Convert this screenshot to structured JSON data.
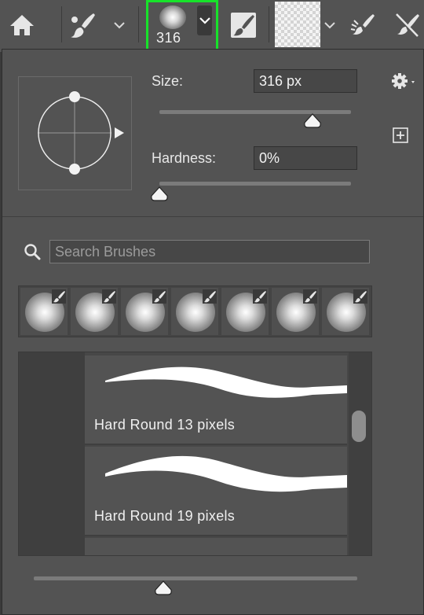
{
  "toolbar": {
    "home": {
      "icon": "home-icon"
    },
    "brush_tool": {
      "icon": "brush-tool-icon",
      "chevron": "⌄"
    },
    "brush_preset": {
      "size_value": "316",
      "chevron": "⌄",
      "highlight_color": "#17e32a"
    },
    "brush_settings": {
      "icon": "brush-settings-panel-icon"
    },
    "pattern": {
      "chevron": "⌄"
    },
    "airbrush": {
      "icon": "airbrush-icon"
    },
    "smoothing": {
      "icon": "brush-angle-icon"
    }
  },
  "panel": {
    "size_label": "Size:",
    "size_value": "316 px",
    "hardness_label": "Hardness:",
    "hardness_value": "0%",
    "size_slider_fraction": 0.8,
    "hardness_slider_fraction": 0.0,
    "search_placeholder": "Search Brushes",
    "recent_brushes_count_label": "",
    "brushes": [
      {
        "name": "Hard Round 13 pixels"
      },
      {
        "name": "Hard Round 19 pixels"
      }
    ],
    "preview_size_fraction": 0.4
  }
}
